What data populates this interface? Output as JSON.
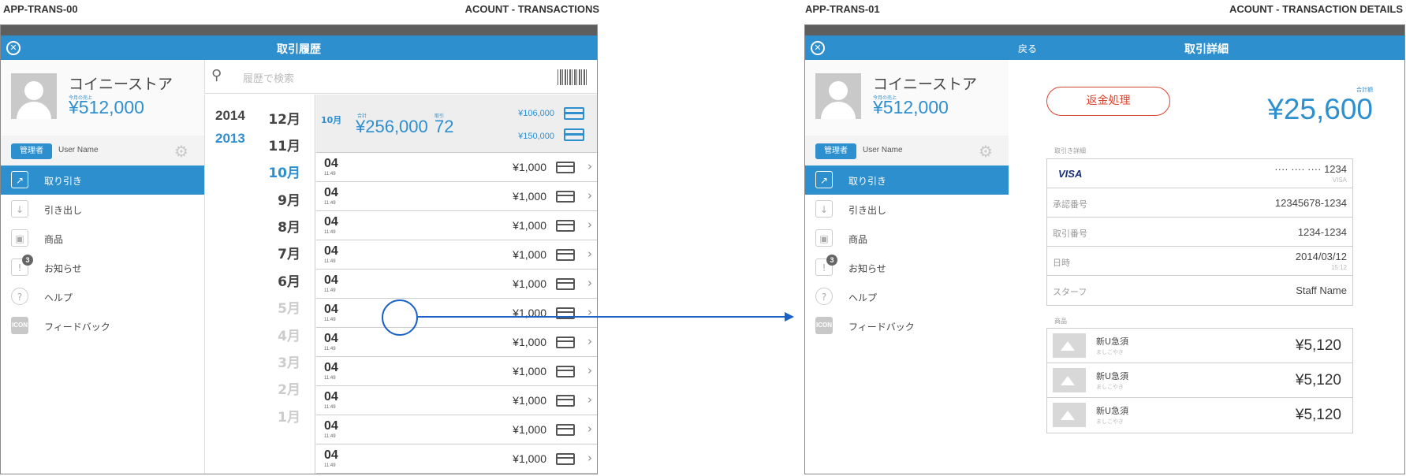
{
  "left_screen": {
    "code": "APP-TRANS-00",
    "title": "ACOUNT - TRANSACTIONS",
    "header_title": "取引履歴",
    "search_placeholder": "履歴で検索",
    "years": [
      "2014",
      "2013"
    ],
    "selected_year": "2013",
    "months": [
      "12月",
      "11月",
      "10月",
      "9月",
      "8月",
      "7月",
      "6月",
      "5月",
      "4月",
      "3月",
      "2月",
      "1月"
    ],
    "selected_month": "10月",
    "summary": {
      "month": "10月",
      "total_label": "合計",
      "total": "¥256,000",
      "count_label": "取引",
      "count": "72",
      "cash_total": "¥106,000",
      "card_total": "¥150,000"
    },
    "transactions": [
      {
        "day": "04",
        "time": "11:49",
        "amount": "¥1,000"
      },
      {
        "day": "04",
        "time": "11:49",
        "amount": "¥1,000"
      },
      {
        "day": "04",
        "time": "11:49",
        "amount": "¥1,000"
      },
      {
        "day": "04",
        "time": "11:49",
        "amount": "¥1,000"
      },
      {
        "day": "04",
        "time": "11:49",
        "amount": "¥1,000"
      },
      {
        "day": "04",
        "time": "11:49",
        "amount": "¥1,000"
      },
      {
        "day": "04",
        "time": "11:49",
        "amount": "¥1,000"
      },
      {
        "day": "04",
        "time": "11:49",
        "amount": "¥1,000"
      },
      {
        "day": "04",
        "time": "11:49",
        "amount": "¥1,000"
      },
      {
        "day": "04",
        "time": "11:49",
        "amount": "¥1,000"
      },
      {
        "day": "04",
        "time": "11:49",
        "amount": "¥1,000"
      }
    ]
  },
  "right_screen": {
    "code": "APP-TRANS-01",
    "title": "ACOUNT - TRANSACTION DETAILS",
    "header_title": "取引詳細",
    "back_label": "戻る",
    "refund_label": "返金処理",
    "total_label": "合計額",
    "total": "¥25,600",
    "details_label": "取引き詳細",
    "card_brand": "VISA",
    "card_number": "···· ···· ···· 1234",
    "card_sub": "VISA",
    "details": [
      {
        "key": "承認番号",
        "value": "12345678-1234"
      },
      {
        "key": "取引番号",
        "value": "1234-1234"
      },
      {
        "key": "日時",
        "value": "2014/03/12",
        "sub": "15:12"
      },
      {
        "key": "スターフ",
        "value": "Staff Name"
      }
    ],
    "products_label": "商品",
    "products": [
      {
        "name": "新U急須",
        "sub": "ましこやき",
        "price": "¥5,120"
      },
      {
        "name": "新U急須",
        "sub": "ましこやき",
        "price": "¥5,120"
      },
      {
        "name": "新U急須",
        "sub": "ましこやき",
        "price": "¥5,120"
      }
    ]
  },
  "sidebar": {
    "store_name": "コイニーストア",
    "sales_label": "今月の売上",
    "sales_value": "¥512,000",
    "role_badge": "管理者",
    "user_name": "User Name",
    "items": [
      {
        "label": "取り引き",
        "icon": "chart-icon"
      },
      {
        "label": "引き出し",
        "icon": "download-icon"
      },
      {
        "label": "商品",
        "icon": "product-icon"
      },
      {
        "label": "お知らせ",
        "icon": "notice-icon",
        "badge": "3"
      },
      {
        "label": "ヘルプ",
        "icon": "help-icon"
      },
      {
        "label": "フィードバック",
        "icon": "feedback-icon",
        "icon_text": "ICON"
      }
    ]
  },
  "colors": {
    "accent": "#2e8fcf",
    "refund": "#d8442e",
    "flow": "#1b62c6"
  }
}
